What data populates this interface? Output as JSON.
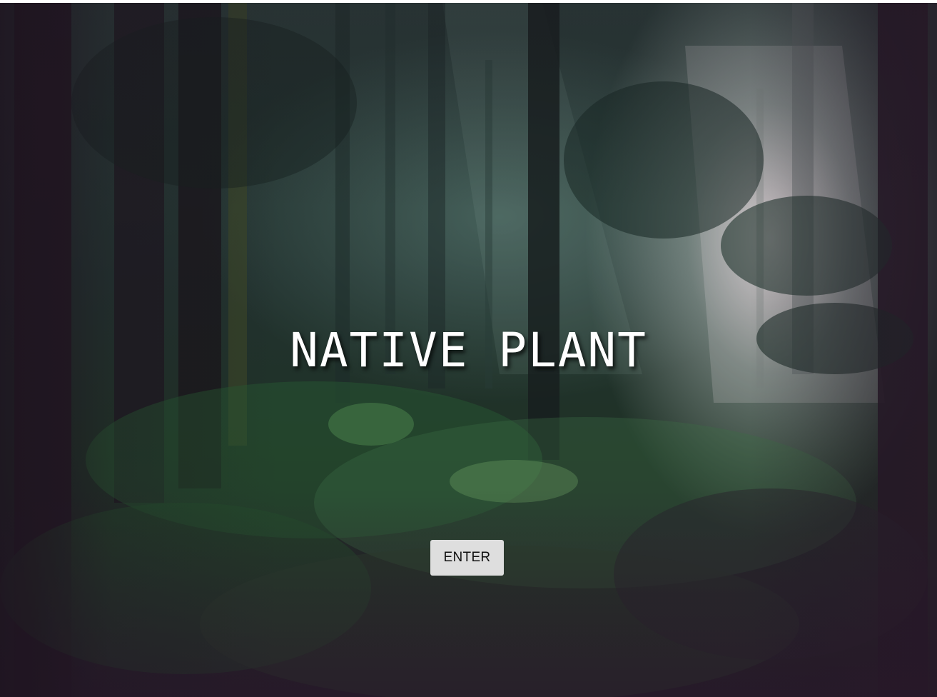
{
  "hero": {
    "title": "NATIVE PLANT",
    "background": "forest-photo",
    "enter_label": "ENTER"
  },
  "colors": {
    "title_text": "#ffffff",
    "button_bg": "#dedede",
    "button_text": "#111111"
  }
}
